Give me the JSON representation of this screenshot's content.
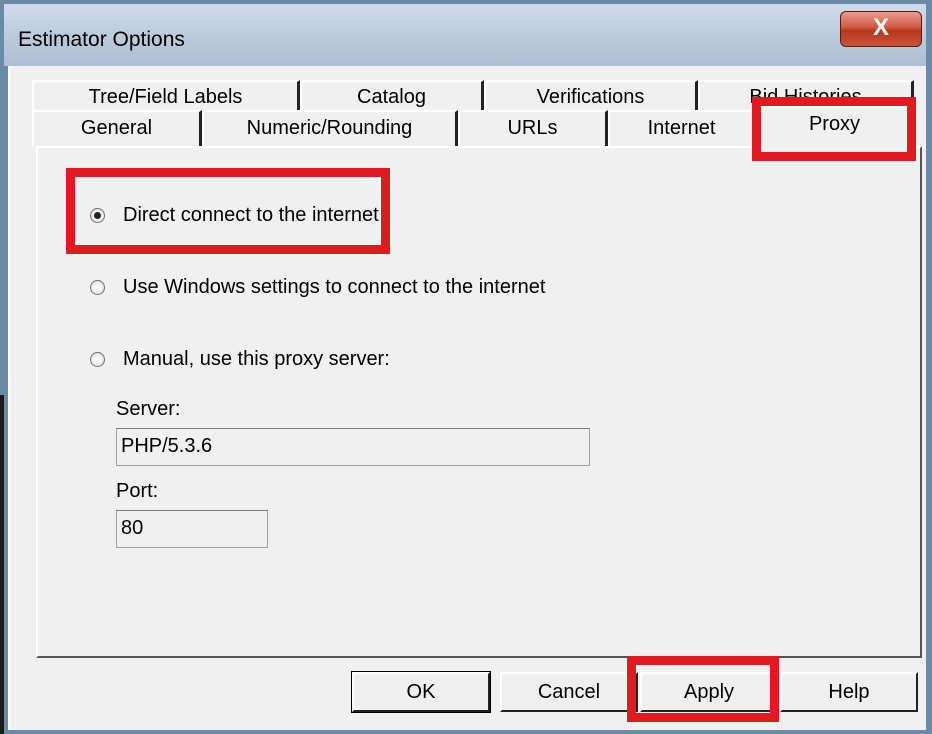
{
  "window": {
    "title": "Estimator Options",
    "close_label": "X"
  },
  "tabs": {
    "row1": [
      "Tree/Field Labels",
      "Catalog",
      "Verifications",
      "Bid Histories"
    ],
    "row2": [
      "General",
      "Numeric/Rounding",
      "URLs",
      "Internet",
      "Proxy"
    ],
    "selected": "Proxy"
  },
  "proxy": {
    "options": [
      {
        "label": "Direct connect to the internet",
        "checked": true
      },
      {
        "label": "Use Windows settings to connect to the internet",
        "checked": false
      },
      {
        "label": "Manual, use this proxy server:",
        "checked": false
      }
    ],
    "server_label": "Server:",
    "server_value": "PHP/5.3.6",
    "port_label": "Port:",
    "port_value": "80"
  },
  "buttons": {
    "ok": "OK",
    "cancel": "Cancel",
    "apply": "Apply",
    "help": "Help"
  },
  "colors": {
    "highlight": "#e31921",
    "close_button": "#c8452c"
  }
}
